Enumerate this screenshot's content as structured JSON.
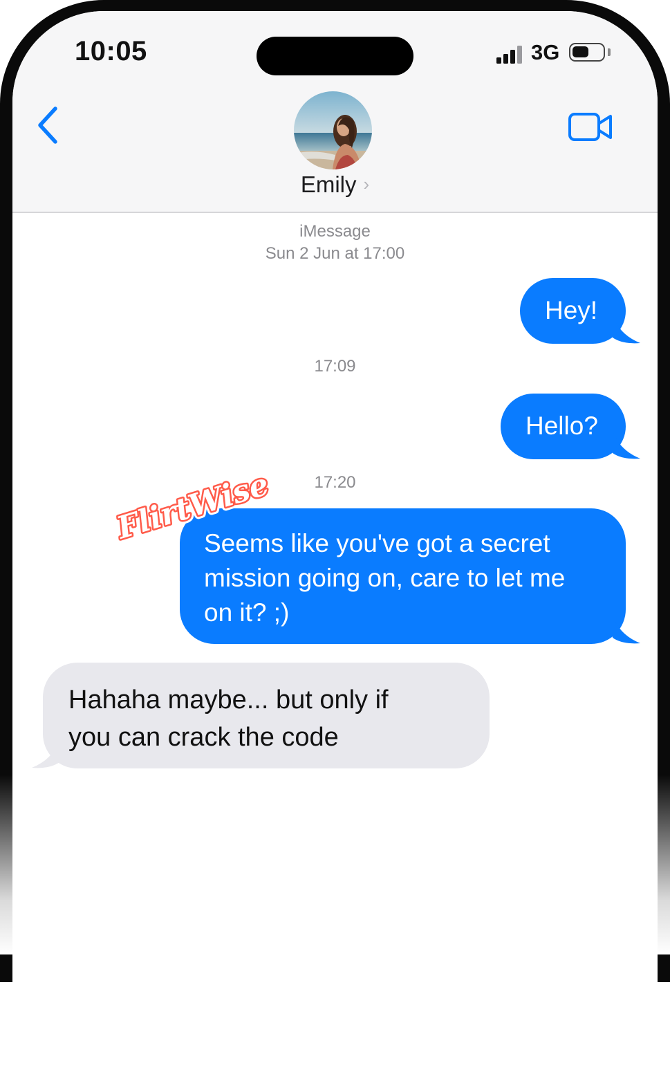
{
  "status_bar": {
    "time": "10:05",
    "network": "3G",
    "signal_bars": 4,
    "battery_level": 0.55
  },
  "header": {
    "back_icon": "chevron-left-icon",
    "contact_name": "Emily",
    "chevron_icon": "chevron-right-icon",
    "video_icon": "video-camera-icon"
  },
  "conversation": {
    "service": "iMessage",
    "date": "Sun 2 Jun at 17:00",
    "messages": [
      {
        "direction": "outgoing",
        "text": "Hey!"
      },
      {
        "timestamp": "17:09"
      },
      {
        "direction": "outgoing",
        "text": "Hello?"
      },
      {
        "timestamp": "17:20"
      },
      {
        "direction": "outgoing",
        "text_lines": [
          "Seems like you've got a secret",
          "mission going on, care to let me",
          "on it? ;)"
        ]
      },
      {
        "direction": "incoming",
        "text_lines": [
          "Hahaha maybe... but only if",
          "you can crack the code"
        ]
      }
    ]
  },
  "watermark": {
    "logo_text": "FlirtWise"
  },
  "colors": {
    "outgoing_bubble": "#0a7cff",
    "incoming_bubble": "#e8e8ed",
    "accent": "#0a7cff",
    "badge": "#ff5b4a"
  }
}
